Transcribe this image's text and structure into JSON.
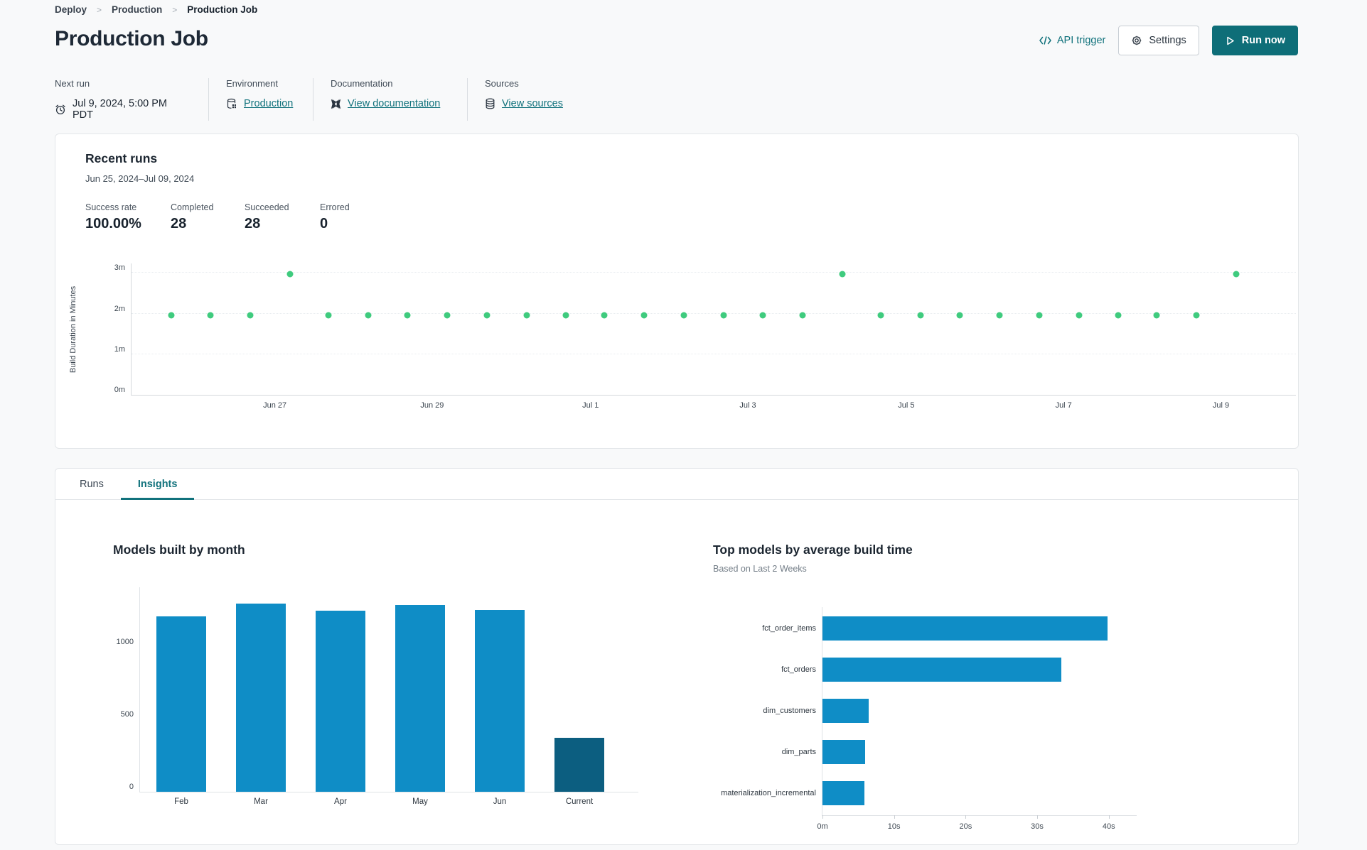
{
  "breadcrumb": {
    "items": [
      "Deploy",
      "Production",
      "Production Job"
    ]
  },
  "header": {
    "title": "Production Job",
    "api_trigger_label": "API trigger",
    "settings_label": "Settings",
    "run_now_label": "Run now"
  },
  "meta": {
    "next_run": {
      "label": "Next run",
      "value": "Jul 9, 2024, 5:00 PM PDT"
    },
    "environment": {
      "label": "Environment",
      "value": "Production"
    },
    "documentation": {
      "label": "Documentation",
      "value": "View documentation"
    },
    "sources": {
      "label": "Sources",
      "value": "View sources"
    }
  },
  "recent_runs": {
    "title": "Recent runs",
    "date_range": "Jun 25, 2024–Jul 09, 2024",
    "stats": [
      {
        "label": "Success rate",
        "value": "100.00%"
      },
      {
        "label": "Completed",
        "value": "28"
      },
      {
        "label": "Succeeded",
        "value": "28"
      },
      {
        "label": "Errored",
        "value": "0"
      }
    ]
  },
  "tabs": [
    {
      "label": "Runs",
      "active": false
    },
    {
      "label": "Insights",
      "active": true
    }
  ],
  "colors": {
    "accent_teal": "#11727c",
    "run_now_bg": "#0e6e78",
    "dot_green": "#3fcb7e",
    "bar_blue": "#0f8dc6",
    "bar_dark": "#0c5e80"
  },
  "chart_data": [
    {
      "type": "scatter",
      "ylabel": "Build Duration in Minutes",
      "ylim": [
        0,
        3.25
      ],
      "yticks": [
        {
          "label": "0m",
          "value": 0
        },
        {
          "label": "1m",
          "value": 1
        },
        {
          "label": "2m",
          "value": 2
        },
        {
          "label": "3m",
          "value": 3
        }
      ],
      "xticks": [
        {
          "label": "Jun 27",
          "pos": 0.123
        },
        {
          "label": "Jun 29",
          "pos": 0.258
        },
        {
          "label": "Jul 1",
          "pos": 0.394
        },
        {
          "label": "Jul 3",
          "pos": 0.529
        },
        {
          "label": "Jul 5",
          "pos": 0.665
        },
        {
          "label": "Jul 7",
          "pos": 0.8
        },
        {
          "label": "Jul 9",
          "pos": 0.935
        }
      ],
      "point_color": "#3fcb7e",
      "points": [
        {
          "pos": 0.034,
          "minutes": 1.95
        },
        {
          "pos": 0.068,
          "minutes": 1.95
        },
        {
          "pos": 0.102,
          "minutes": 1.95
        },
        {
          "pos": 0.136,
          "minutes": 2.97
        },
        {
          "pos": 0.169,
          "minutes": 1.95
        },
        {
          "pos": 0.203,
          "minutes": 1.95
        },
        {
          "pos": 0.237,
          "minutes": 1.95
        },
        {
          "pos": 0.271,
          "minutes": 1.95
        },
        {
          "pos": 0.305,
          "minutes": 1.95
        },
        {
          "pos": 0.339,
          "minutes": 1.95
        },
        {
          "pos": 0.373,
          "minutes": 1.95
        },
        {
          "pos": 0.406,
          "minutes": 1.95
        },
        {
          "pos": 0.44,
          "minutes": 1.95
        },
        {
          "pos": 0.474,
          "minutes": 1.95
        },
        {
          "pos": 0.508,
          "minutes": 1.95
        },
        {
          "pos": 0.542,
          "minutes": 1.95
        },
        {
          "pos": 0.576,
          "minutes": 1.95
        },
        {
          "pos": 0.61,
          "minutes": 2.97
        },
        {
          "pos": 0.643,
          "minutes": 1.95
        },
        {
          "pos": 0.677,
          "minutes": 1.95
        },
        {
          "pos": 0.711,
          "minutes": 1.95
        },
        {
          "pos": 0.745,
          "minutes": 1.95
        },
        {
          "pos": 0.779,
          "minutes": 1.95
        },
        {
          "pos": 0.813,
          "minutes": 1.95
        },
        {
          "pos": 0.847,
          "minutes": 1.95
        },
        {
          "pos": 0.88,
          "minutes": 1.95
        },
        {
          "pos": 0.914,
          "minutes": 1.95
        },
        {
          "pos": 0.948,
          "minutes": 2.97
        }
      ]
    },
    {
      "type": "bar",
      "title": "Models built by month",
      "categories": [
        "Feb",
        "Mar",
        "Apr",
        "May",
        "Jun",
        "Current"
      ],
      "values": [
        1210,
        1300,
        1250,
        1290,
        1255,
        375
      ],
      "bar_colors": [
        "#0f8dc6",
        "#0f8dc6",
        "#0f8dc6",
        "#0f8dc6",
        "#0f8dc6",
        "#0c5e80"
      ],
      "yticks": [
        0,
        500,
        1000
      ],
      "ylim": [
        0,
        1417
      ]
    },
    {
      "type": "bar-horizontal",
      "title": "Top models by average build time",
      "subtitle": "Based on Last 2 Weeks",
      "categories": [
        "fct_order_items",
        "fct_orders",
        "dim_customers",
        "dim_parts",
        "materialization_incremental"
      ],
      "values_seconds": [
        39.8,
        33.4,
        6.5,
        6.0,
        5.9
      ],
      "xticks": [
        {
          "label": "0m",
          "value": 0
        },
        {
          "label": "10s",
          "value": 10
        },
        {
          "label": "20s",
          "value": 20
        },
        {
          "label": "30s",
          "value": 30
        },
        {
          "label": "40s",
          "value": 40
        }
      ],
      "xlim": [
        0,
        44
      ],
      "bar_color": "#0f8dc6"
    }
  ]
}
